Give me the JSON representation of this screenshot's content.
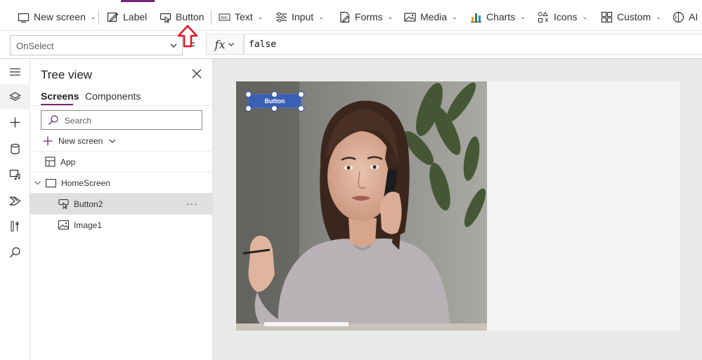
{
  "ribbon": {
    "items": [
      {
        "label": "New screen",
        "icon": "new-screen-icon",
        "has_chevron": true
      },
      {
        "label": "Label",
        "icon": "label-edit-icon",
        "has_chevron": false
      },
      {
        "label": "Button",
        "icon": "button-pointer-icon",
        "has_chevron": false
      },
      {
        "label": "Text",
        "icon": "text-input-icon",
        "has_chevron": true
      },
      {
        "label": "Input",
        "icon": "input-sliders-icon",
        "has_chevron": true
      },
      {
        "label": "Forms",
        "icon": "forms-icon",
        "has_chevron": true
      },
      {
        "label": "Media",
        "icon": "image-icon",
        "has_chevron": true
      },
      {
        "label": "Charts",
        "icon": "bar-chart-icon",
        "has_chevron": true
      },
      {
        "label": "Icons",
        "icon": "icons-shapes-icon",
        "has_chevron": true
      },
      {
        "label": "Custom",
        "icon": "custom-components-icon",
        "has_chevron": true
      },
      {
        "label": "AI",
        "icon": "ai-brain-icon",
        "has_chevron": false
      }
    ]
  },
  "formula_bar": {
    "property": "OnSelect",
    "fx_label": "fx",
    "equals": "=",
    "formula": "false"
  },
  "tree_view": {
    "title": "Tree view",
    "tabs": [
      "Screens",
      "Components"
    ],
    "selected_tab": "Screens",
    "search_placeholder": "Search",
    "new_screen_label": "New screen",
    "items": [
      {
        "label": "App",
        "icon": "app-icon",
        "indent": 0
      },
      {
        "label": "HomeScreen",
        "icon": "screen-icon",
        "indent": 0,
        "expanded": true
      },
      {
        "label": "Button2",
        "icon": "button-icon",
        "indent": 1,
        "selected": true,
        "more": "···"
      },
      {
        "label": "Image1",
        "icon": "image-icon",
        "indent": 1
      }
    ]
  },
  "canvas": {
    "button_text": "Button"
  },
  "colors": {
    "accent": "#742774",
    "button_fill": "#3a5fb5",
    "annotation": "#e81123"
  }
}
